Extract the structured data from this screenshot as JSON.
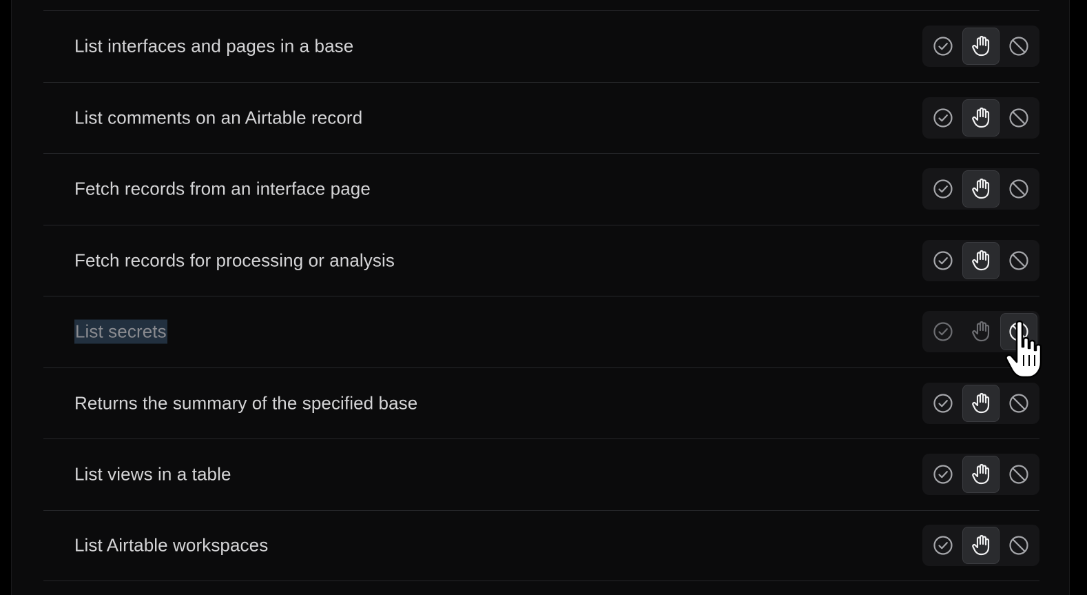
{
  "colors": {
    "background": "#0b0b0c",
    "divider": "#26272a",
    "label": "#d4d4d6",
    "label_disabled": "#8a8b90",
    "selection_highlight": "#22303f",
    "segment_bg": "#161618",
    "segment_active_bg": "#2a2b2e",
    "icon": "#a6a7ab",
    "icon_active": "#f2f2f3",
    "icon_dim": "#6d6e72"
  },
  "icons": {
    "allow": "check-circle-icon",
    "ask": "hand-icon",
    "block": "block-icon"
  },
  "tools": [
    {
      "label": "List interfaces and pages in a base",
      "permission": "ask"
    },
    {
      "label": "List comments on an Airtable record",
      "permission": "ask"
    },
    {
      "label": "Fetch records from an interface page",
      "permission": "ask"
    },
    {
      "label": "Fetch records for processing or analysis",
      "permission": "ask"
    },
    {
      "label": "List secrets",
      "permission": "block"
    },
    {
      "label": "Returns the summary of the specified base",
      "permission": "ask"
    },
    {
      "label": "List views in a table",
      "permission": "ask"
    },
    {
      "label": "List Airtable workspaces",
      "permission": "ask"
    }
  ]
}
